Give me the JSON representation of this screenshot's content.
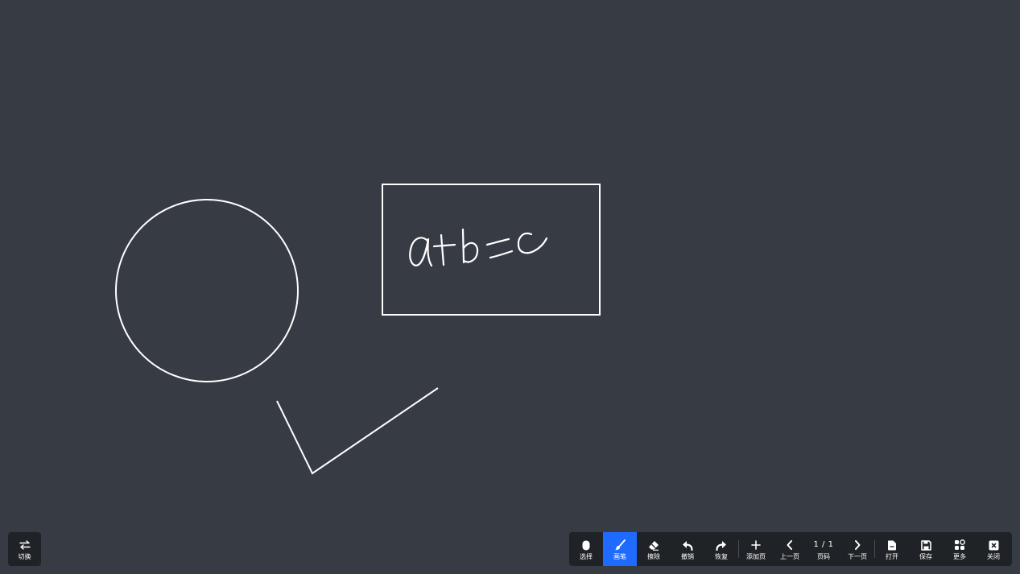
{
  "app": {
    "background_color": "#373b43",
    "ink_color": "#ffffff",
    "accent_color": "#1f6bff"
  },
  "canvas": {
    "handwriting_text": "a+b=c"
  },
  "switch": {
    "label": "切换",
    "icon": "swap-arrows-icon"
  },
  "toolbar": {
    "select": {
      "label": "选择",
      "icon": "mouse-icon"
    },
    "pen": {
      "label": "画笔",
      "icon": "brush-icon",
      "active": true
    },
    "eraser": {
      "label": "擦除",
      "icon": "eraser-icon"
    },
    "undo": {
      "label": "撤销",
      "icon": "undo-icon"
    },
    "redo": {
      "label": "恢复",
      "icon": "redo-icon"
    },
    "add_page": {
      "label": "添加页",
      "icon": "plus-icon"
    },
    "prev_page": {
      "label": "上一页",
      "icon": "chevron-left-icon"
    },
    "page_number": {
      "label": "页码",
      "value": "1 / 1"
    },
    "next_page": {
      "label": "下一页",
      "icon": "chevron-right-icon"
    },
    "open": {
      "label": "打开",
      "icon": "folder-icon"
    },
    "save": {
      "label": "保存",
      "icon": "save-icon"
    },
    "more": {
      "label": "更多",
      "icon": "apps-icon"
    },
    "close": {
      "label": "关闭",
      "icon": "close-box-icon"
    }
  }
}
